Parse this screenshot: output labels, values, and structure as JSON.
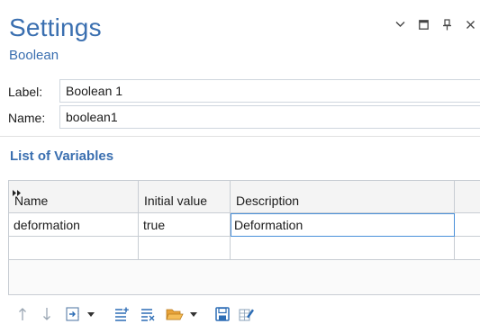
{
  "header": {
    "title": "Settings",
    "subtitle": "Boolean",
    "controls": [
      "chevron-down-icon",
      "maximize-icon",
      "pin-icon",
      "close-icon"
    ]
  },
  "fields": {
    "label": {
      "caption": "Label:",
      "value": "Boolean 1"
    },
    "name": {
      "caption": "Name:",
      "value": "boolean1"
    }
  },
  "variables": {
    "section_title": "List of Variables",
    "columns": [
      "Name",
      "Initial value",
      "Description"
    ],
    "rows": [
      {
        "name": "deformation",
        "initial_value": "true",
        "description": "Deformation"
      }
    ]
  },
  "toolbar": {
    "icons": [
      "move-up-icon",
      "move-down-icon",
      "insert-expression-icon",
      "dropdown-arrow-icon",
      "add-row-icon",
      "delete-row-icon",
      "load-from-file-icon",
      "dropdown-arrow-icon",
      "save-to-file-icon",
      "clear-table-icon"
    ]
  },
  "colors": {
    "accent": "#3a6fb0",
    "border": "#c8cdd3",
    "edit_border": "#4a90d9"
  }
}
